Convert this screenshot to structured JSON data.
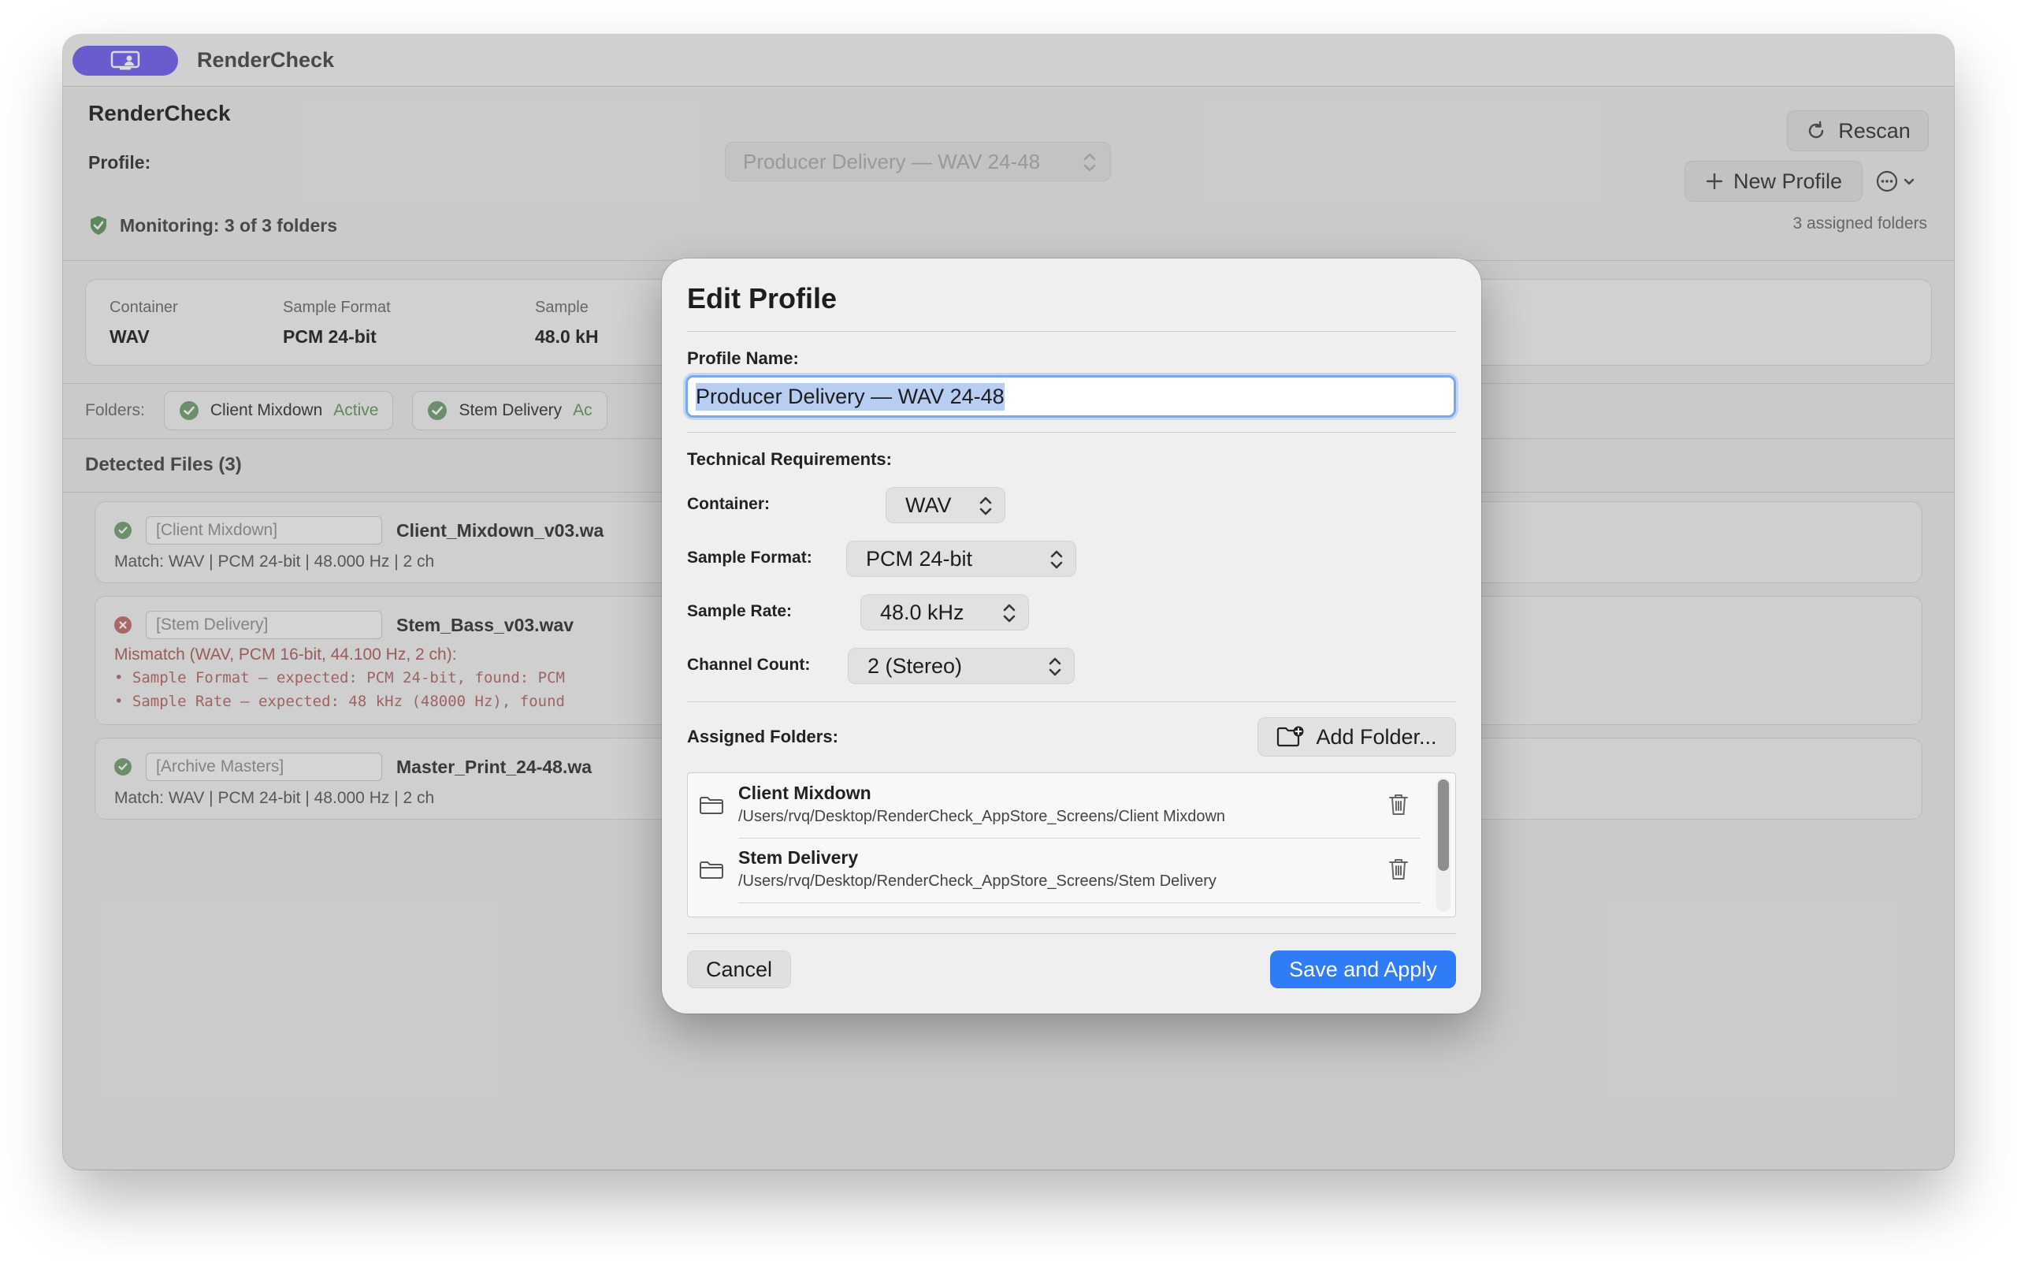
{
  "window": {
    "title": "RenderCheck"
  },
  "header": {
    "app_title": "RenderCheck",
    "profile_label": "Profile:",
    "profile_value": "Producer Delivery — WAV 24-48",
    "rescan_label": "Rescan",
    "new_profile_label": "New Profile",
    "monitoring": "Monitoring: 3 of 3 folders",
    "assigned_folders": "3 assigned folders"
  },
  "requirements": [
    {
      "label": "Container",
      "value": "WAV"
    },
    {
      "label": "Sample Format",
      "value": "PCM 24-bit"
    },
    {
      "label": "Sample",
      "value": "48.0 kH"
    }
  ],
  "folders_bar": {
    "label": "Folders:",
    "chips": [
      {
        "name": "Client Mixdown",
        "status": "Active"
      },
      {
        "name": "Stem Delivery",
        "status": "Ac"
      }
    ]
  },
  "detected": {
    "title": "Detected Files (3)",
    "files": [
      {
        "tag": "[Client Mixdown]",
        "name": "Client_Mixdown_v03.wa",
        "line1": "Match: WAV | PCM 24-bit | 48.000 Hz | 2 ch",
        "status": "ok"
      },
      {
        "tag": "[Stem Delivery]",
        "name": "Stem_Bass_v03.wav",
        "line1": "Mismatch (WAV, PCM 16-bit, 44.100 Hz, 2 ch):",
        "bullets": [
          "• Sample Format — expected: PCM 24-bit, found: PCM",
          "• Sample Rate — expected: 48 kHz (48000 Hz), found"
        ],
        "status": "error"
      },
      {
        "tag": "[Archive Masters]",
        "name": "Master_Print_24-48.wa",
        "line1": "Match: WAV | PCM 24-bit | 48.000 Hz | 2 ch",
        "status": "ok"
      }
    ]
  },
  "modal": {
    "title": "Edit Profile",
    "profile_name_label": "Profile Name:",
    "profile_name_value": "Producer Delivery — WAV 24-48",
    "tech_label": "Technical Requirements:",
    "container_label": "Container:",
    "container_value": "WAV",
    "sample_format_label": "Sample Format:",
    "sample_format_value": "PCM 24-bit",
    "sample_rate_label": "Sample Rate:",
    "sample_rate_value": "48.0 kHz",
    "channel_count_label": "Channel Count:",
    "channel_count_value": "2 (Stereo)",
    "assigned_label": "Assigned Folders:",
    "add_folder_label": "Add Folder...",
    "folders": [
      {
        "name": "Client Mixdown",
        "path": "/Users/rvq/Desktop/RenderCheck_AppStore_Screens/Client Mixdown"
      },
      {
        "name": "Stem Delivery",
        "path": "/Users/rvq/Desktop/RenderCheck_AppStore_Screens/Stem Delivery"
      }
    ],
    "cancel_label": "Cancel",
    "save_label": "Save and Apply"
  },
  "colors": {
    "accent": "#2f7cf6",
    "focus_ring": "#7aa8ee",
    "app_icon": "#7b6cf2",
    "ok": "#7fa67f",
    "error": "#c47a7a"
  },
  "icons": [
    "app-icon",
    "chevron-updown-icon",
    "refresh-icon",
    "plus-icon",
    "ellipsis-icon",
    "chevron-down-icon",
    "checkmark-shield-icon",
    "checkmark-circle-icon",
    "xmark-circle-icon",
    "folder-badge-plus-icon",
    "folder-icon",
    "trash-icon"
  ]
}
